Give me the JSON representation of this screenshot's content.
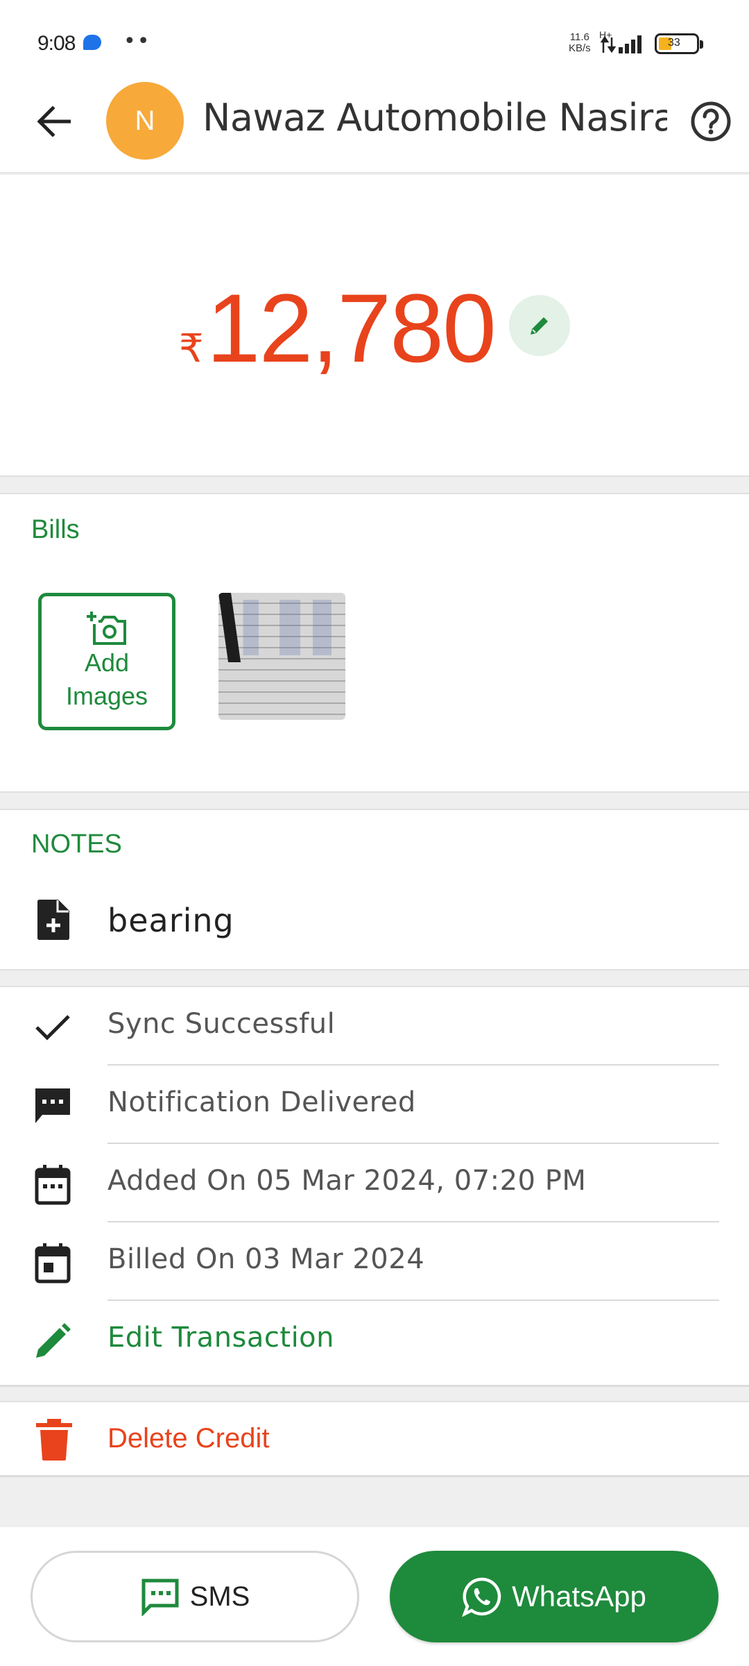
{
  "status_bar": {
    "time": "9:08",
    "dots": "••",
    "net_speed": "11.6",
    "net_unit": "KB/s",
    "network_type": "H+",
    "battery": "33"
  },
  "header": {
    "avatar_initial": "N",
    "title": "Nawaz Automobile Nasira...",
    "back_icon": "arrow-left-icon",
    "help_icon": "question-circle-icon"
  },
  "amount": {
    "currency": "₹",
    "value": "12,780",
    "color": "#e8431c"
  },
  "bills": {
    "title": "Bills",
    "add_images_line1": "Add",
    "add_images_line2": "Images"
  },
  "notes": {
    "title": "NOTES",
    "text": "bearing"
  },
  "info": {
    "sync": "Sync Successful",
    "notification": "Notification Delivered",
    "added_on": "Added On 05 Mar 2024, 07:20 PM",
    "billed_on": "Billed On 03 Mar 2024",
    "edit": "Edit Transaction"
  },
  "delete": {
    "label": "Delete Credit"
  },
  "actions": {
    "sms": "SMS",
    "whatsapp": "WhatsApp"
  },
  "colors": {
    "brand_green": "#1e8a3c",
    "danger_red": "#e8431c",
    "avatar": "#f7a93a"
  }
}
